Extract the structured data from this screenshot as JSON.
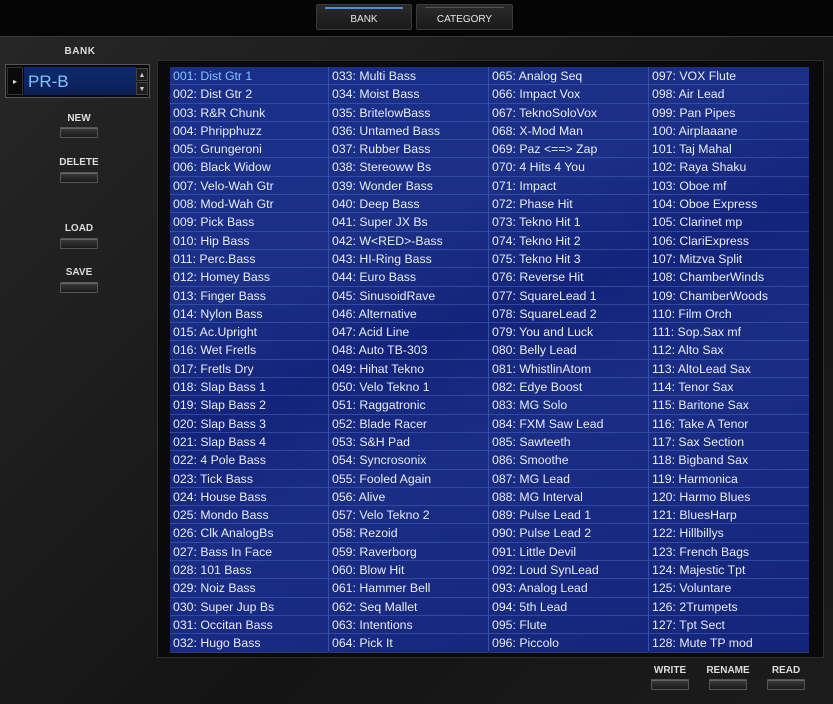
{
  "tabs": [
    {
      "label": "BANK",
      "active": true
    },
    {
      "label": "CATEGORY",
      "active": false
    }
  ],
  "left_panel": {
    "bank_label": "BANK",
    "bank_value": "PR-B",
    "buttons": [
      "NEW",
      "DELETE",
      "LOAD",
      "SAVE"
    ]
  },
  "bottom_buttons": [
    "WRITE",
    "RENAME",
    "READ"
  ],
  "selected_index": 0,
  "patch_columns": [
    [
      "001: Dist Gtr 1",
      "002: Dist Gtr 2",
      "003: R&R Chunk",
      "004: Phripphuzz",
      "005: Grungeroni",
      "006: Black Widow",
      "007: Velo-Wah Gtr",
      "008: Mod-Wah Gtr",
      "009: Pick Bass",
      "010: Hip Bass",
      "011: Perc.Bass",
      "012: Homey Bass",
      "013: Finger Bass",
      "014: Nylon Bass",
      "015: Ac.Upright",
      "016: Wet Fretls",
      "017: Fretls Dry",
      "018: Slap Bass 1",
      "019: Slap Bass 2",
      "020: Slap Bass 3",
      "021: Slap Bass 4",
      "022: 4 Pole Bass",
      "023: Tick Bass",
      "024: House Bass",
      "025: Mondo Bass",
      "026: Clk AnalogBs",
      "027: Bass In Face",
      "028: 101  Bass",
      "029: Noiz Bass",
      "030: Super Jup Bs",
      "031: Occitan Bass",
      "032: Hugo Bass"
    ],
    [
      "033: Multi Bass",
      "034: Moist Bass",
      "035: BritelowBass",
      "036: Untamed Bass",
      "037: Rubber Bass",
      "038: Stereoww Bs",
      "039: Wonder Bass",
      "040: Deep Bass",
      "041: Super JX Bs",
      "042: W<RED>-Bass",
      "043: HI-Ring Bass",
      "044: Euro Bass",
      "045: SinusoidRave",
      "046: Alternative",
      "047: Acid Line",
      "048: Auto TB-303",
      "049: Hihat Tekno",
      "050: Velo Tekno 1",
      "051: Raggatronic",
      "052: Blade Racer",
      "053: S&H Pad",
      "054: Syncrosonix",
      "055: Fooled Again",
      "056: Alive",
      "057: Velo Tekno 2",
      "058: Rezoid",
      "059: Raverborg",
      "060: Blow Hit",
      "061: Hammer Bell",
      "062: Seq Mallet",
      "063: Intentions",
      "064: Pick It"
    ],
    [
      "065: Analog Seq",
      "066: Impact Vox",
      "067: TeknoSoloVox",
      "068: X-Mod Man",
      "069: Paz <==> Zap",
      "070: 4 Hits 4 You",
      "071: Impact",
      "072: Phase Hit",
      "073: Tekno Hit 1",
      "074: Tekno Hit 2",
      "075: Tekno Hit 3",
      "076: Reverse Hit",
      "077: SquareLead 1",
      "078: SquareLead 2",
      "079: You and Luck",
      "080: Belly Lead",
      "081: WhistlinAtom",
      "082: Edye Boost",
      "083: MG Solo",
      "084: FXM Saw Lead",
      "085: Sawteeth",
      "086: Smoothe",
      "087: MG Lead",
      "088: MG Interval",
      "089: Pulse Lead 1",
      "090: Pulse Lead 2",
      "091: Little Devil",
      "092: Loud SynLead",
      "093: Analog Lead",
      "094: 5th Lead",
      "095: Flute",
      "096: Piccolo"
    ],
    [
      "097: VOX Flute",
      "098: Air Lead",
      "099: Pan Pipes",
      "100: Airplaaane",
      "101: Taj Mahal",
      "102: Raya Shaku",
      "103: Oboe mf",
      "104: Oboe Express",
      "105: Clarinet mp",
      "106: ClariExpress",
      "107: Mitzva Split",
      "108: ChamberWinds",
      "109: ChamberWoods",
      "110: Film Orch",
      "111: Sop.Sax mf",
      "112: Alto Sax",
      "113: AltoLead Sax",
      "114: Tenor Sax",
      "115: Baritone Sax",
      "116: Take A Tenor",
      "117: Sax Section",
      "118: Bigband Sax",
      "119: Harmonica",
      "120: Harmo Blues",
      "121: BluesHarp",
      "122: Hillbillys",
      "123: French Bags",
      "124: Majestic Tpt",
      "125: Voluntare",
      "126: 2Trumpets",
      "127: Tpt Sect",
      "128: Mute TP mod"
    ]
  ]
}
